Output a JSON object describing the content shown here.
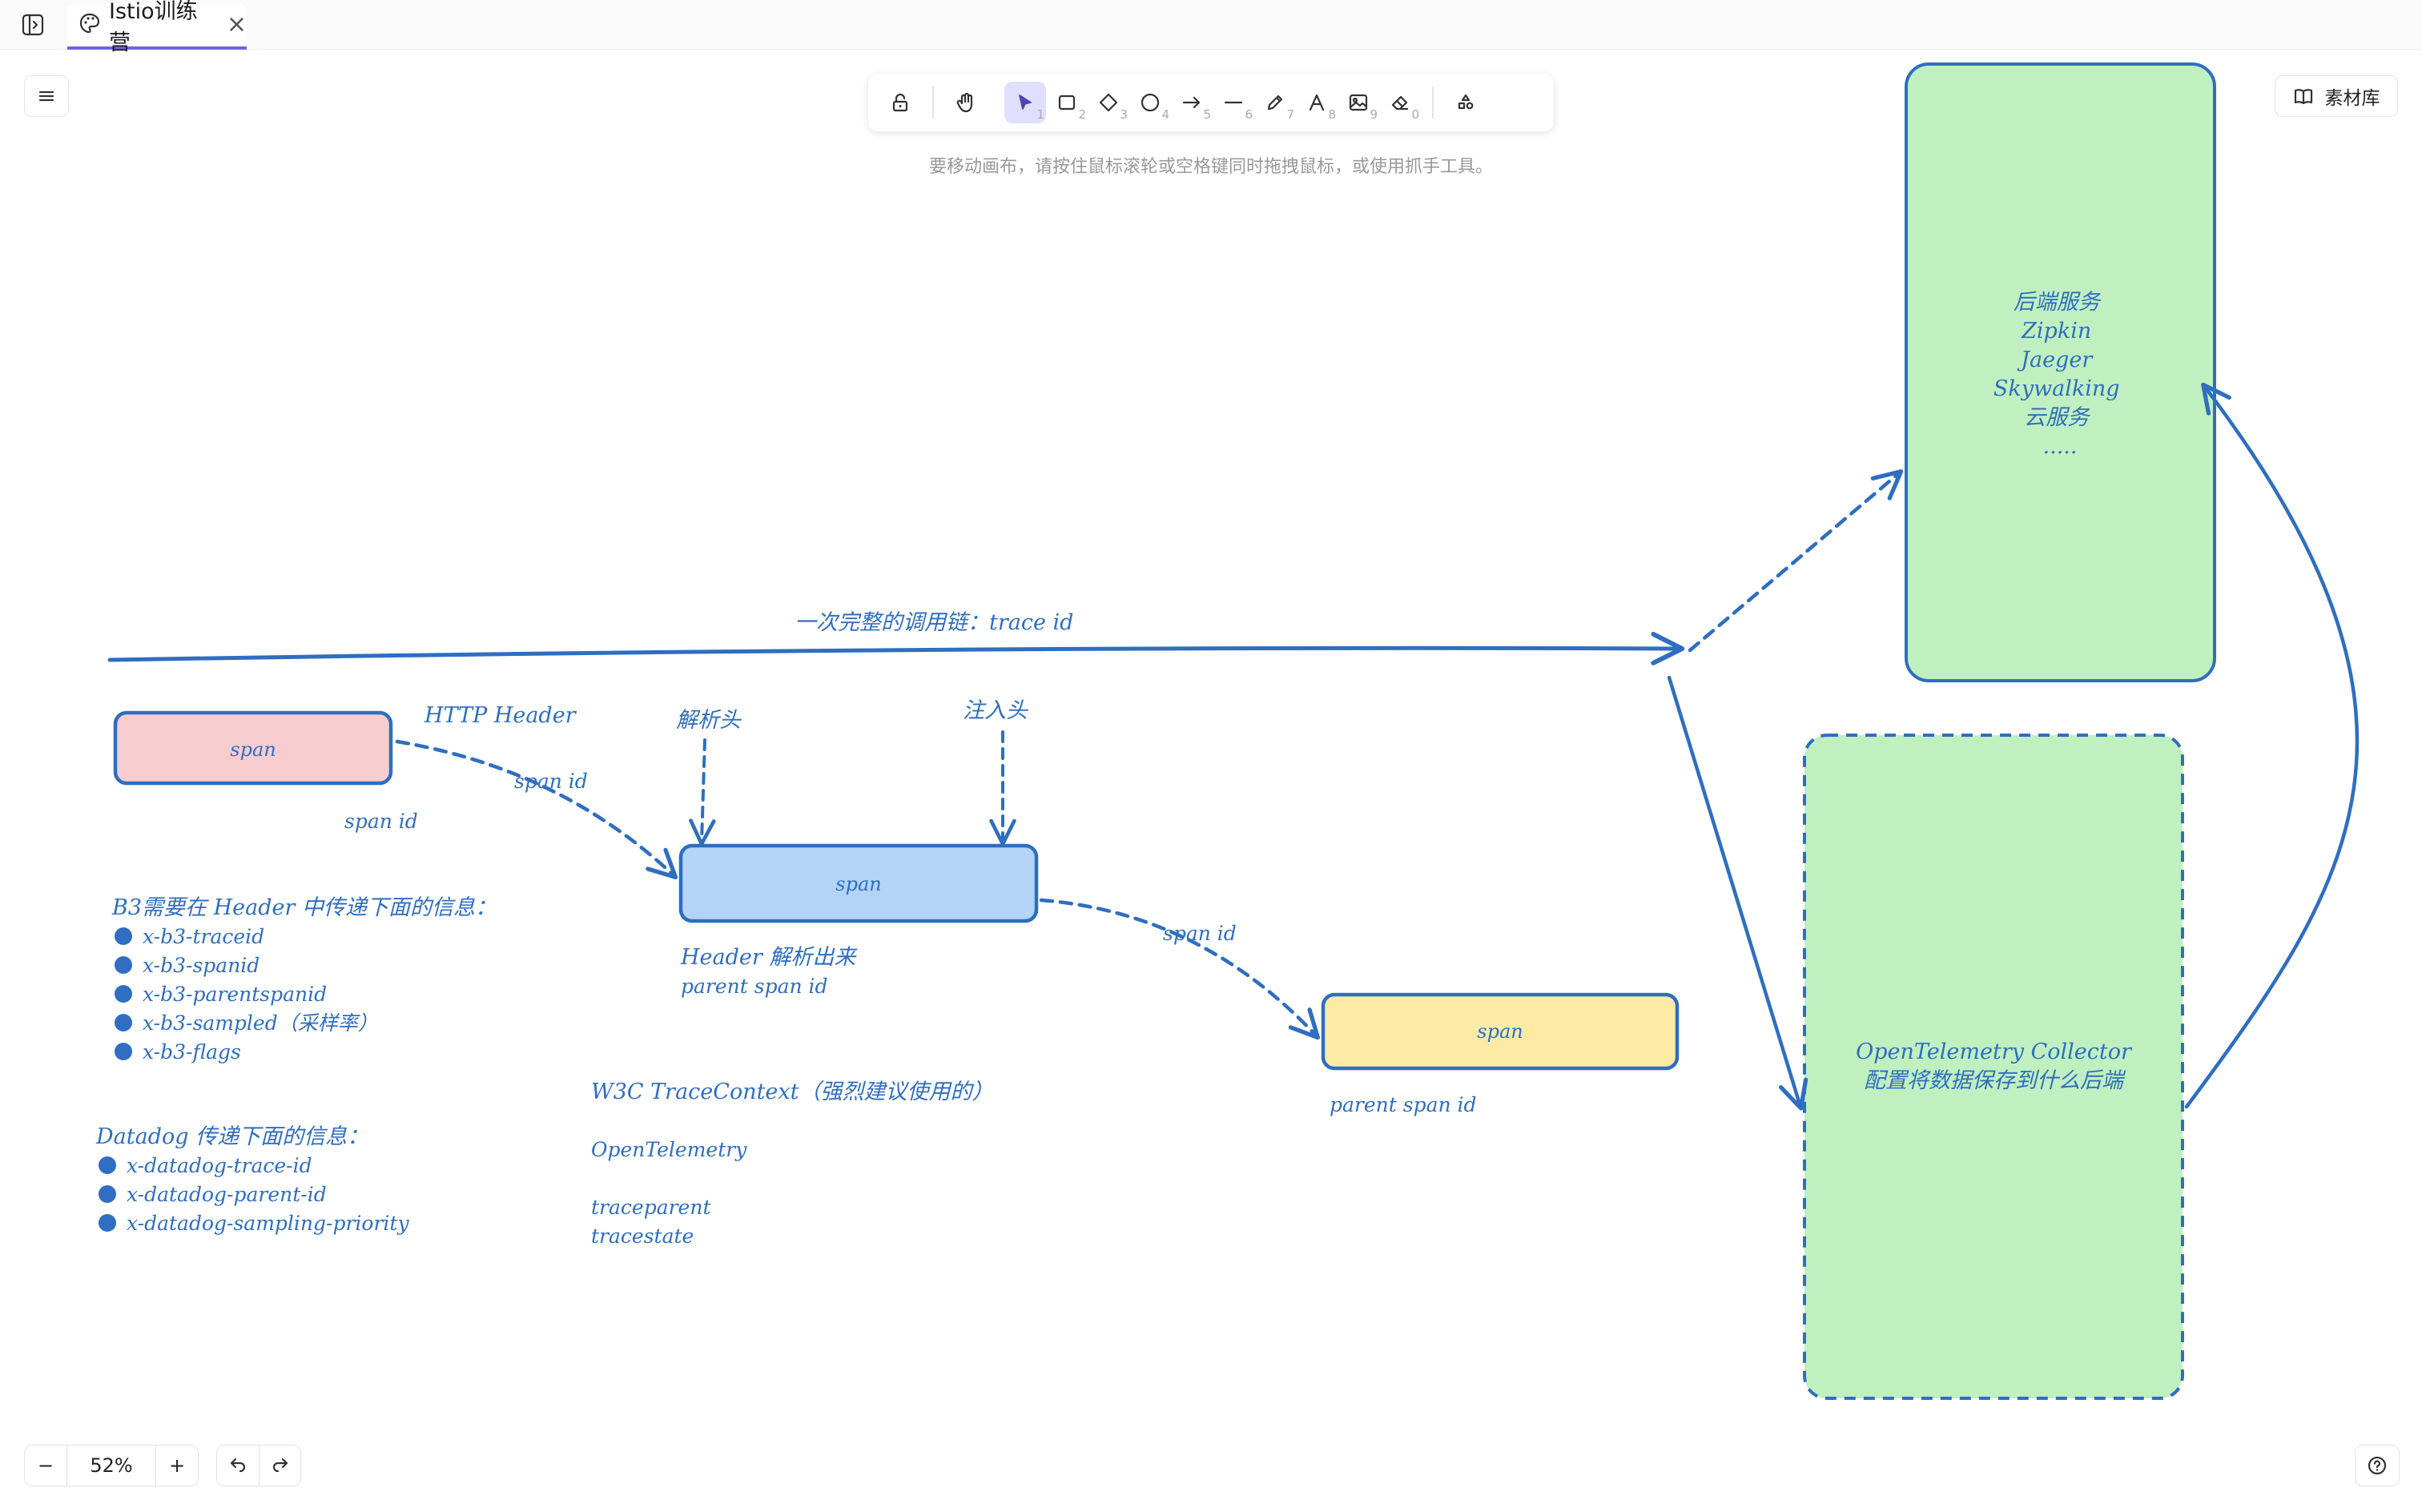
{
  "tab": {
    "title": "Istio训练营",
    "close": "×"
  },
  "toolbar": {
    "keys": [
      "1",
      "2",
      "3",
      "4",
      "5",
      "6",
      "7",
      "8",
      "9",
      "0"
    ],
    "hint": "要移动画布，请按住鼠标滚轮或空格键同时拖拽鼠标，或使用抓手工具。"
  },
  "library": {
    "label": "素材库"
  },
  "zoom": {
    "minus": "−",
    "value": "52%",
    "plus": "+"
  },
  "canvas": {
    "backend_box_lines": [
      "后端服务",
      "Zipkin",
      "Jaeger",
      "Skywalking",
      "云服务",
      "....."
    ],
    "trace_label": "一次完整的调用链：trace id",
    "span1": "span",
    "span2": "span",
    "span3": "span",
    "http_header": "HTTP Header",
    "span_id_1": "span id",
    "span_id_2": "span id",
    "span_id_3": "span id",
    "parse_header": "解析头",
    "inject_header": "注入头",
    "header_parse_out": "Header 解析出来",
    "parent_span_id_1": "parent span id",
    "parent_span_id_2": "parent span id",
    "b3_title": "B3需要在 Header 中传递下面的信息：",
    "b3_items": [
      "x-b3-traceid",
      "x-b3-spanid",
      "x-b3-parentspanid",
      "x-b3-sampled（采样率）",
      "x-b3-flags"
    ],
    "datadog_title": "Datadog 传递下面的信息：",
    "datadog_items": [
      "x-datadog-trace-id",
      "x-datadog-parent-id",
      "x-datadog-sampling-priority"
    ],
    "w3c_title": "W3C TraceContext（强烈建议使用的）",
    "opentelemetry": "OpenTelemetry",
    "traceparent": "traceparent",
    "tracestate": "tracestate",
    "collector_line1": "OpenTelemetry Collector",
    "collector_line2": "配置将数据保存到什么后端"
  },
  "colors": {
    "stroke": "#2f6ec0",
    "span1_fill": "#f7cdd0",
    "span2_fill": "#b3d4f7",
    "span3_fill": "#fdeba5",
    "green_fill": "#c0f0c0",
    "accent": "#6965db"
  },
  "icons": [
    "sidebar-toggle-icon",
    "palette-icon",
    "lock-icon",
    "hand-icon",
    "cursor-icon",
    "rectangle-icon",
    "diamond-icon",
    "circle-icon",
    "arrow-icon",
    "line-icon",
    "pencil-icon",
    "text-icon",
    "image-icon",
    "eraser-icon",
    "shapes-icon",
    "book-icon",
    "undo-icon",
    "redo-icon",
    "help-icon"
  ]
}
